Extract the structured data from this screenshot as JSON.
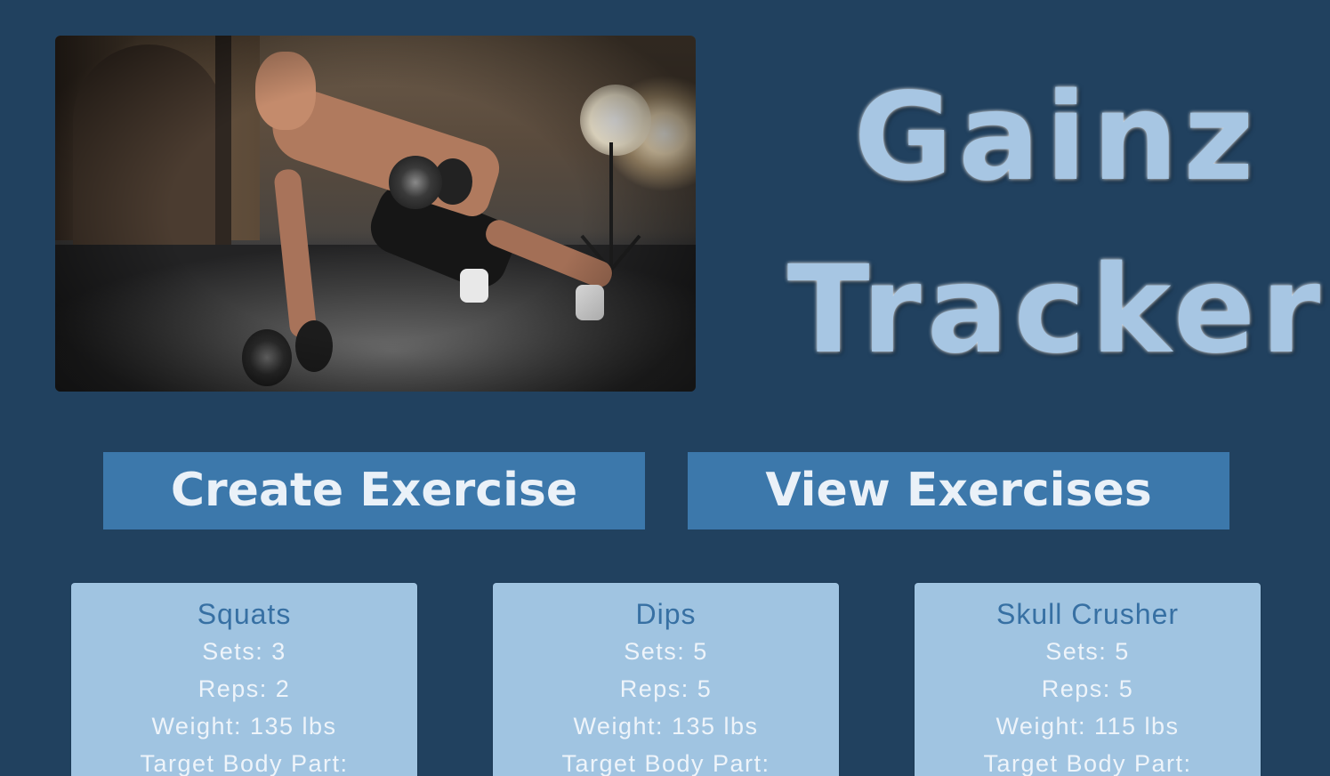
{
  "app": {
    "title_line1": "Gainz",
    "title_line2": "Tracker",
    "hero_image": "man doing dumbbell push-up row in warehouse"
  },
  "colors": {
    "background": "#21415f",
    "button": "#3c78ab",
    "card": "#a0c4e1",
    "title": "#a7c6e3",
    "exercise_name": "#3770a3"
  },
  "nav": {
    "create_label": "Create Exercise",
    "view_label": "View Exercises"
  },
  "exercises": [
    {
      "name": "Squats",
      "sets": "Sets: 3",
      "reps": "Reps: 2",
      "weight": "Weight: 135 lbs",
      "target": "Target Body Part:"
    },
    {
      "name": "Dips",
      "sets": "Sets: 5",
      "reps": "Reps: 5",
      "weight": "Weight: 135 lbs",
      "target": "Target Body Part:"
    },
    {
      "name": "Skull Crusher",
      "sets": "Sets: 5",
      "reps": "Reps: 5",
      "weight": "Weight: 115 lbs",
      "target": "Target Body Part:"
    }
  ]
}
